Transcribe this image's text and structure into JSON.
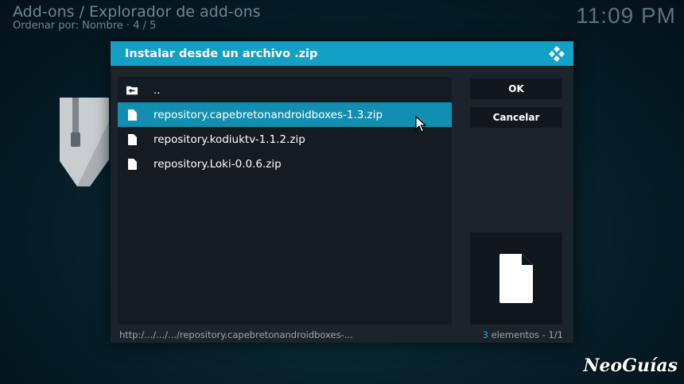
{
  "background": {
    "breadcrumb": "Add-ons / Explorador de add-ons",
    "sort_label": "Ordenar por: Nombre",
    "sort_separator": "·",
    "page_counter": "4 / 5",
    "clock": "11:09 PM"
  },
  "dialog": {
    "title": "Instalar desde un archivo .zip",
    "items": [
      {
        "label": "..",
        "icon": "folder-back-icon"
      },
      {
        "label": "repository.capebretonandroidboxes-1.3.zip",
        "icon": "file-icon"
      },
      {
        "label": "repository.kodiuktv-1.1.2.zip",
        "icon": "file-icon"
      },
      {
        "label": "repository.Loki-0.0.6.zip",
        "icon": "file-icon"
      }
    ],
    "focused_index": 1,
    "ok_label": "OK",
    "cancel_label": "Cancelar",
    "footer_path": "http:/.../.../.../repository.capebretonandroidboxes-...",
    "count_number": "3",
    "count_text": " elementos - 1/1"
  },
  "watermark": "NeoGuías",
  "colors": {
    "accent": "#12a0c4",
    "focus": "#128fb0",
    "dialog_bg": "#1b242b"
  }
}
